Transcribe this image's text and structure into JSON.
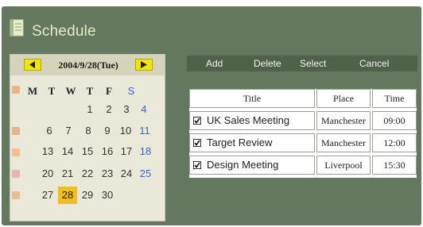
{
  "header": {
    "title": "Schedule",
    "icon": "calendar-book-icon"
  },
  "calendar": {
    "date_label": "2004/9/28(Tue)",
    "prev_icon": "left-arrow-icon",
    "next_icon": "right-arrow-icon",
    "weekdays": [
      "M",
      "T",
      "W",
      "T",
      "F",
      "S"
    ],
    "days": [
      "1",
      "2",
      "3",
      "4",
      "6",
      "7",
      "8",
      "9",
      "10",
      "11",
      "13",
      "14",
      "15",
      "16",
      "17",
      "18",
      "20",
      "21",
      "22",
      "23",
      "24",
      "25",
      "27",
      "28",
      "29",
      "30"
    ],
    "selected_day": "28",
    "accent_color": "#f3bd1a",
    "weekend_color": "#3a64c8"
  },
  "toolbar": {
    "add": "Add",
    "delete": "Delete",
    "select": "Select",
    "cancel": "Cancel"
  },
  "table": {
    "headers": {
      "title": "Title",
      "place": "Place",
      "time": "Time"
    },
    "rows": [
      {
        "title": "UK Sales Meeting",
        "place": "Manchester",
        "time": "09:00",
        "checked": true
      },
      {
        "title": "Target Review",
        "place": "Manchester",
        "time": "12:00",
        "checked": true
      },
      {
        "title": "Design Meeting",
        "place": "Liverpool",
        "time": "15:30",
        "checked": true
      }
    ]
  },
  "colors": {
    "panel": "#63785e",
    "toolbar": "#4e6149",
    "header_text": "#e3ecc4"
  }
}
